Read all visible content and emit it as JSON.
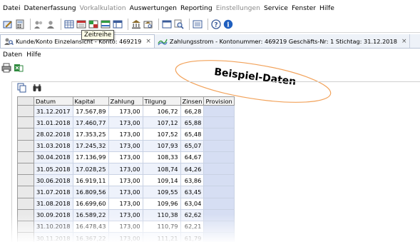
{
  "menubar": {
    "items": [
      {
        "label": "Datei",
        "enabled": true
      },
      {
        "label": "Datenerfassung",
        "enabled": true
      },
      {
        "label": "Vorkalkulation",
        "enabled": false
      },
      {
        "label": "Auswertungen",
        "enabled": true
      },
      {
        "label": "Reporting",
        "enabled": true
      },
      {
        "label": "Einstellungen",
        "enabled": false
      },
      {
        "label": "Service",
        "enabled": true
      },
      {
        "label": "Fenster",
        "enabled": true
      },
      {
        "label": "Hilfe",
        "enabled": true
      }
    ]
  },
  "toolbar": {
    "tooltip": "Zeitreihe",
    "icons": [
      "pencil-icon",
      "calculator-icon",
      "users-icon",
      "user-icon",
      "grid-icon",
      "calendar-icon",
      "grid-color-icon",
      "table-color-icon",
      "table-icon",
      "bank-icon",
      "bank-search-icon",
      "window-icon",
      "magnifier-icon",
      "list-icon",
      "help-icon",
      "info-icon"
    ]
  },
  "tabs": [
    {
      "label": "Kunde/Konto Einzelansicht - Konto: 469219",
      "active": true,
      "close": "×"
    },
    {
      "label": "Zahlungsstrom - Kontonummer: 469219 Geschäfts-Nr: 1 Stichtag: 31.12.2018",
      "active": false,
      "close": "×"
    }
  ],
  "submenu": {
    "items": [
      "Daten",
      "Hilfe"
    ]
  },
  "callout": {
    "text": "Beispiel-Daten"
  },
  "colors": {
    "tab_bar": "#eef2f8",
    "date_column": "#eef2fb",
    "provision_column": "#d6def3",
    "info_icon": "#1f5fbf"
  },
  "table": {
    "columns": [
      "Datum",
      "Kapital",
      "Zahlung",
      "Tilgung",
      "Zinsen",
      "Provision"
    ],
    "rows": [
      [
        "31.12.2017",
        "17.567,89",
        "173,00",
        "106,72",
        "66,28",
        ""
      ],
      [
        "31.01.2018",
        "17.460,77",
        "173,00",
        "107,12",
        "65,88",
        ""
      ],
      [
        "28.02.2018",
        "17.353,25",
        "173,00",
        "107,52",
        "65,48",
        ""
      ],
      [
        "31.03.2018",
        "17.245,32",
        "173,00",
        "107,93",
        "65,07",
        ""
      ],
      [
        "30.04.2018",
        "17.136,99",
        "173,00",
        "108,33",
        "64,67",
        ""
      ],
      [
        "31.05.2018",
        "17.028,25",
        "173,00",
        "108,74",
        "64,26",
        ""
      ],
      [
        "30.06.2018",
        "16.919,11",
        "173,00",
        "109,14",
        "63,86",
        ""
      ],
      [
        "31.07.2018",
        "16.809,56",
        "173,00",
        "109,55",
        "63,45",
        ""
      ],
      [
        "31.08.2018",
        "16.699,60",
        "173,00",
        "109,96",
        "63,04",
        ""
      ],
      [
        "30.09.2018",
        "16.589,22",
        "173,00",
        "110,38",
        "62,62",
        ""
      ],
      [
        "31.10.2018",
        "16.478,43",
        "173,00",
        "110,79",
        "62,21",
        ""
      ],
      [
        "30.11.2018",
        "16.367,22",
        "173,00",
        "111,21",
        "61,79",
        ""
      ]
    ]
  }
}
